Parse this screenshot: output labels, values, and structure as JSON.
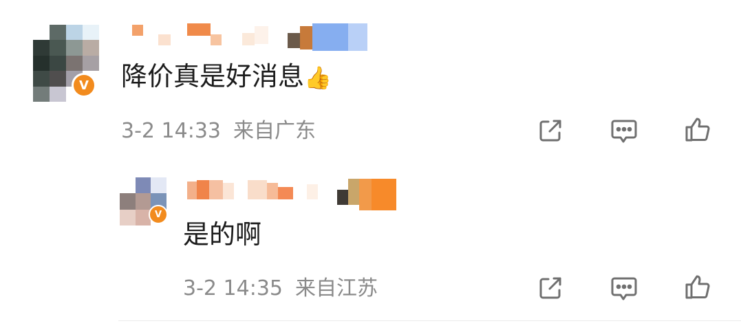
{
  "comments": [
    {
      "text": "降价真是好消息",
      "emoji": "👍",
      "time": "3-2 14:33",
      "location": "来自广东",
      "badge": "V"
    },
    {
      "text": "是的啊",
      "time": "3-2 14:35",
      "location": "来自江苏",
      "badge": "V"
    }
  ],
  "actions": {
    "share_icon": "share-icon",
    "comment_icon": "comment-icon",
    "like_icon": "thumbs-up-icon"
  },
  "colors": {
    "text": "#1c1c1c",
    "meta": "#8a8a8a",
    "icon": "#6f6f6f",
    "badge": "#f28b1e"
  }
}
